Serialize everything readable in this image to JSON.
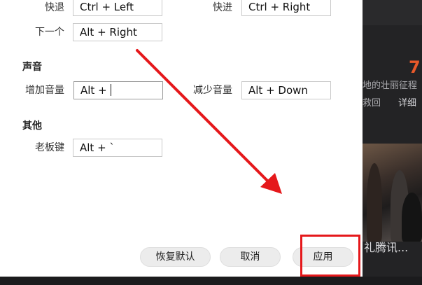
{
  "shortcuts": {
    "row1": {
      "left_label": "快退",
      "left_value": "Ctrl + Left",
      "right_label": "快进",
      "right_value": "Ctrl + Right"
    },
    "row2": {
      "label": "下一个",
      "value": "Alt + Right"
    }
  },
  "sound": {
    "title": "声音",
    "up_label": "增加音量",
    "up_value": "Alt + ",
    "down_label": "减少音量",
    "down_value": "Alt + Down"
  },
  "other": {
    "title": "其他",
    "boss_label": "老板键",
    "boss_value": "Alt + `"
  },
  "buttons": {
    "restore": "恢复默认",
    "cancel": "取消",
    "apply": "应用"
  },
  "background": {
    "number": "7.",
    "line1": "地的壮丽征程",
    "line2": "救回",
    "detail": "详细",
    "caption": "礼腾讯..."
  },
  "colors": {
    "highlight": "#e5181b",
    "arrow": "#e5181b"
  }
}
